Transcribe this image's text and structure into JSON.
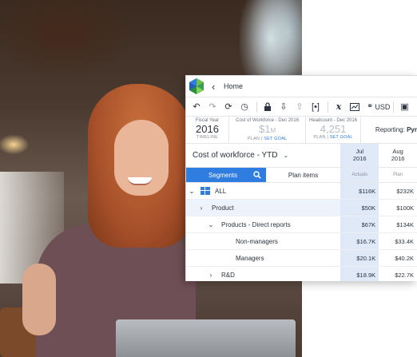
{
  "header": {
    "home_label": "Home"
  },
  "toolbar": {
    "currency_label": "USD"
  },
  "kpis": [
    {
      "label": "Fiscal Year",
      "value": "2016",
      "suffix": "",
      "sub": "TIMELINE",
      "goal": ""
    },
    {
      "label": "Cost of Workforce - Dec 2016",
      "value": "$1",
      "suffix": "M",
      "sub": "PLAN | ",
      "goal": "SET GOAL"
    },
    {
      "label": "Headcount - Dec 2016",
      "value": "4,251",
      "suffix": "",
      "sub": "PLAN | ",
      "goal": "SET GOAL"
    }
  ],
  "reporting": {
    "label": "Reporting:",
    "value": "Pyr"
  },
  "grid": {
    "title": "Cost of workforce - YTD",
    "columns": [
      {
        "month": "Jul",
        "year": "2016",
        "type": "Actuals"
      },
      {
        "month": "Aug",
        "year": "2016",
        "type": "Plan"
      }
    ],
    "tabs": {
      "segments": "Segments",
      "plan_items": "Plan items"
    },
    "rows": [
      {
        "label": "ALL",
        "values": [
          "$116K",
          "$232K"
        ]
      },
      {
        "label": "Product",
        "values": [
          "$50K",
          "$100K"
        ]
      },
      {
        "label": "Products - Direct reports",
        "values": [
          "$67K",
          "$134K"
        ]
      },
      {
        "label": "Non-managers",
        "values": [
          "$16.7K",
          "$33.4K"
        ]
      },
      {
        "label": "Managers",
        "values": [
          "$20.1K",
          "$40.2K"
        ]
      },
      {
        "label": "R&D",
        "values": [
          "$18.9K",
          "$22.7K"
        ]
      }
    ]
  },
  "colors": {
    "accent": "#2f7de1",
    "active_column": "#dfe9f8"
  }
}
